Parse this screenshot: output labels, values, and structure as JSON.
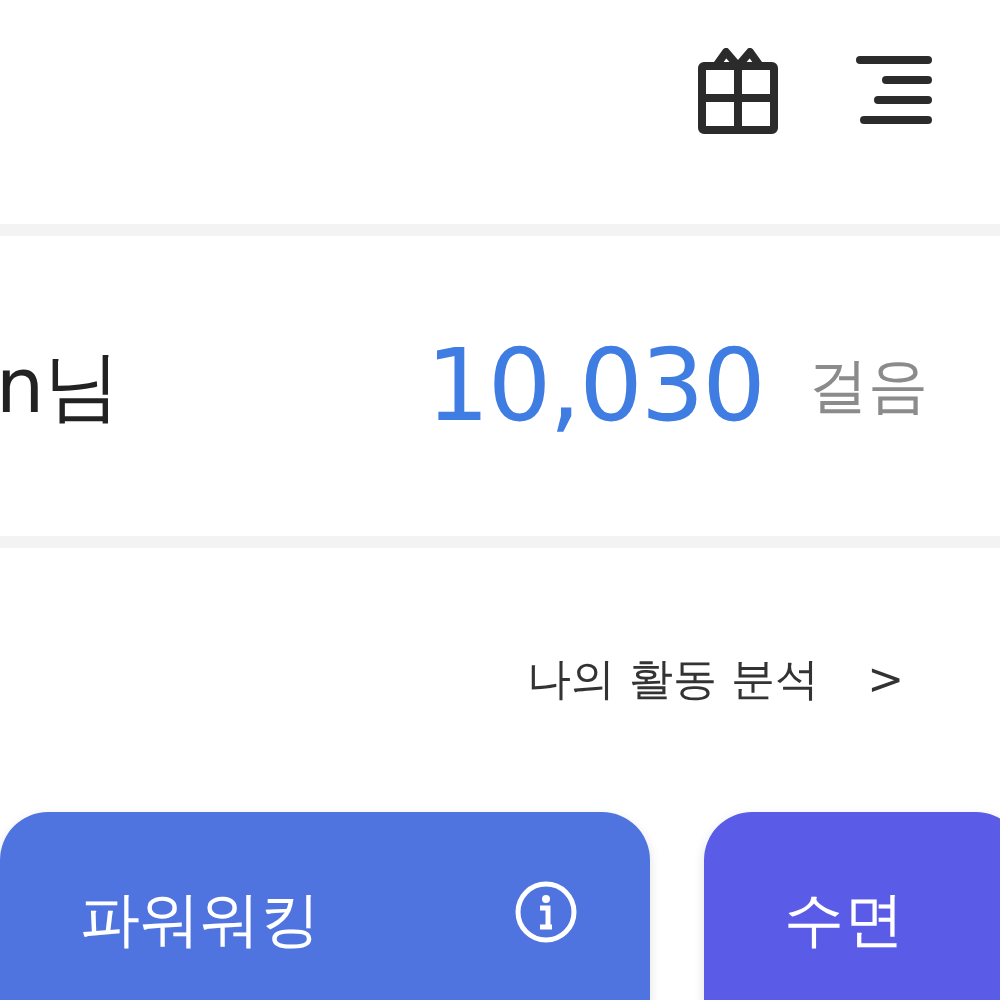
{
  "summary": {
    "user": "n님",
    "steps": "10,030",
    "unit": "걸음"
  },
  "activity_link": {
    "label": "나의 활동 분석",
    "chevron": ">"
  },
  "cards": [
    {
      "title": "파워워킹",
      "info": true,
      "color": "#4f74df"
    },
    {
      "title": "수면",
      "info": false,
      "color": "#5a5be6"
    }
  ]
}
